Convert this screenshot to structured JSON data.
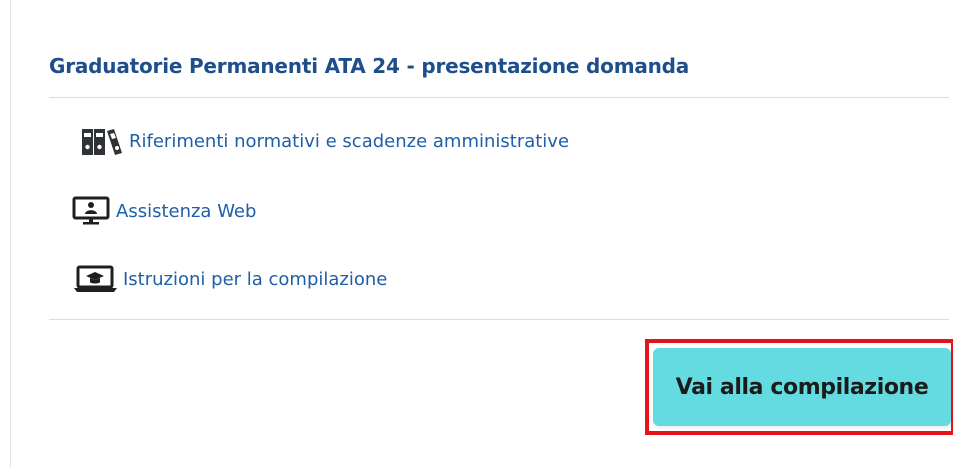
{
  "card": {
    "title": "Graduatorie Permanenti ATA 24 - presentazione domanda"
  },
  "links": [
    {
      "label": "Riferimenti normativi e scadenze amministrative",
      "icon": "binders-icon"
    },
    {
      "label": "Assistenza Web",
      "icon": "monitor-user-icon"
    },
    {
      "label": "Istruzioni per la compilazione",
      "icon": "laptop-graduation-cap-icon"
    }
  ],
  "actions": {
    "primary_label": "Vai alla compilazione"
  },
  "colors": {
    "title": "#1f4f8b",
    "link": "#1f5ea8",
    "button_bg": "#63dbe1",
    "highlight_border": "#e3131b"
  }
}
